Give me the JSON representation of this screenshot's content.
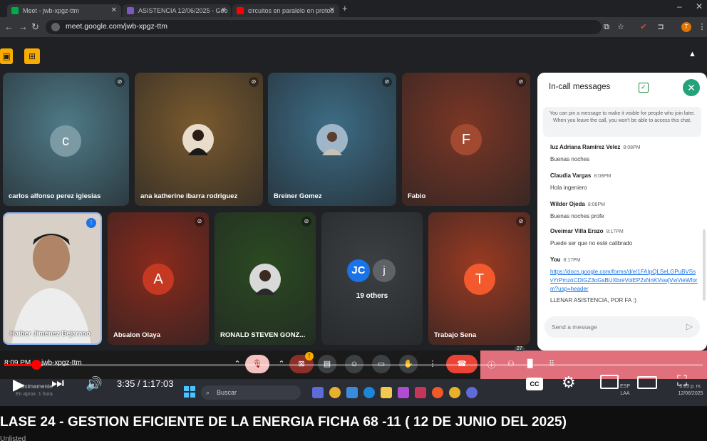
{
  "browser": {
    "tabs": [
      {
        "label": "Meet - jwb-xpgz-ttm"
      },
      {
        "label": "ASISTENCIA 12/06/2025 - Goo"
      },
      {
        "label": "circuitos en paralelo en protob"
      }
    ],
    "url": "meet.google.com/jwb-xpgz-ttm"
  },
  "tiles": [
    {
      "name": "carlos alfonso perez iglesias",
      "initial": "c",
      "color": "#4e7a88"
    },
    {
      "name": "ana katherine ibarra rodriguez",
      "initial": "",
      "color": "#7a5a2e"
    },
    {
      "name": "Breiner Gomez",
      "initial": "",
      "color": "#3d6c85"
    },
    {
      "name": "Fabio",
      "initial": "F",
      "color": "#7b3625"
    },
    {
      "name": "Haiber Jiménez Bejarano",
      "initial": "",
      "color": "#d8d0c6"
    },
    {
      "name": "Absalon Olaya",
      "initial": "A",
      "color": "#8a2a1c"
    },
    {
      "name": "RONALD STEVEN GONZ...",
      "initial": "",
      "color": "#2b4a21"
    },
    {
      "name": "",
      "initial": "",
      "color": "#3c4043",
      "others_label": "19 others",
      "initials_a": "JC",
      "initials_b": "j"
    },
    {
      "name": "Trabajo Sena",
      "initial": "T",
      "color": "#9a3a22"
    }
  ],
  "chat": {
    "title": "In-call messages",
    "info": "You can pin a message to make it visible for people who join later. When you leave the call, you won't be able to access this chat.",
    "messages": [
      {
        "author": "luz Adriana Ramírez Velez",
        "time": "8:08PM",
        "text": "Buenas noches"
      },
      {
        "author": "Claudia Vargas",
        "time": "8:08PM",
        "text": "Hola ingeniero"
      },
      {
        "author": "Wilder Ojeda",
        "time": "8:08PM",
        "text": "Buenas noches profe"
      },
      {
        "author": "Oveimar Villa Erazo",
        "time": "8:17PM",
        "text": "Puede ser que no esté calibrado"
      },
      {
        "author": "You",
        "time": "8:17PM",
        "link": "https://docs.google.com/forms/d/e/1FAIpQLSeLGPuBVSsvYrPmzóCDIGZ3oGsBUXbreVolEP2xNnKVswjVwVieWform?usp=header",
        "text": "LLENAR ASISTENCIA, POR FA :)"
      }
    ],
    "input_placeholder": "Send a message"
  },
  "meetbar": {
    "time": "8:09 PM",
    "code": "jwb-xpgz-ttm",
    "people_badge": "27"
  },
  "taskbar": {
    "search_placeholder": "Buscar",
    "lang": "ESP\nLAA",
    "date": "12/06/2025",
    "clock": "8:09 p. m.",
    "coming_soon": "Próximamente",
    "coming_soon_sub": "En aprox. 1 hora"
  },
  "youtube": {
    "time": "3:35 / 1:17:03",
    "progress": 0.046,
    "title": "LASE 24 - GESTION EFICIENTE DE LA ENERGIA FICHA 68 -11 ( 12 DE JUNIO DEL 2025)",
    "visibility": "Unlisted",
    "cc_label": "CC"
  }
}
